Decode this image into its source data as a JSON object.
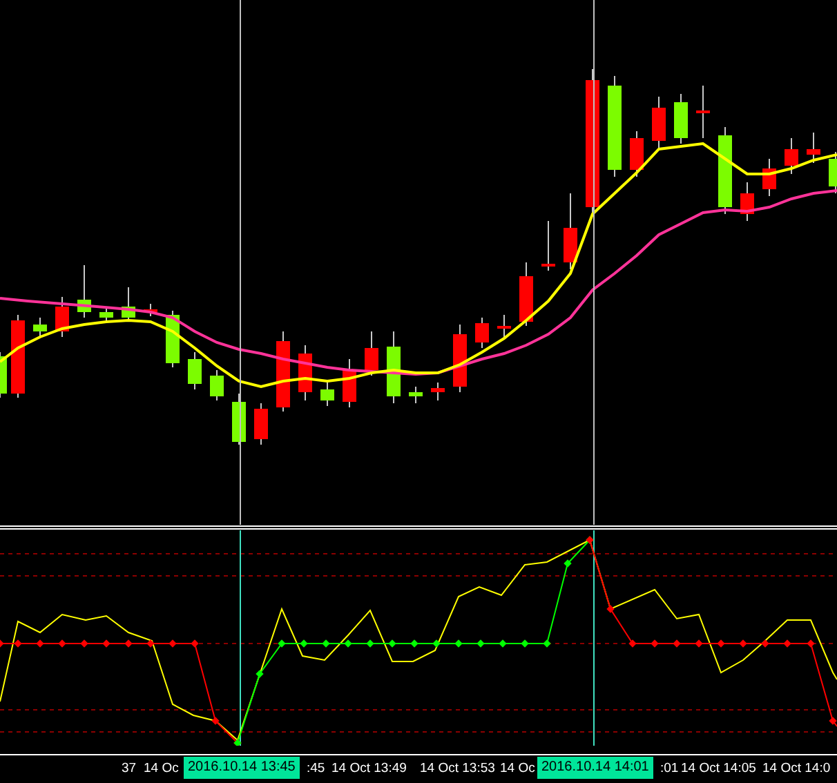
{
  "time_axis": {
    "labels": [
      {
        "text": "37"
      },
      {
        "text": "14 Oc"
      },
      {
        "text": ":45"
      },
      {
        "text": "14 Oct 13:49"
      },
      {
        "text": "14 Oct 13:53"
      },
      {
        "text": "14 Oc"
      },
      {
        "text": ":01"
      },
      {
        "text": "14 Oct 14:05"
      },
      {
        "text": "14 Oct 14:0"
      }
    ],
    "crosshair_labels": [
      {
        "text": "2016.10.14 13:45"
      },
      {
        "text": "2016.10.14 14:01"
      }
    ]
  }
}
